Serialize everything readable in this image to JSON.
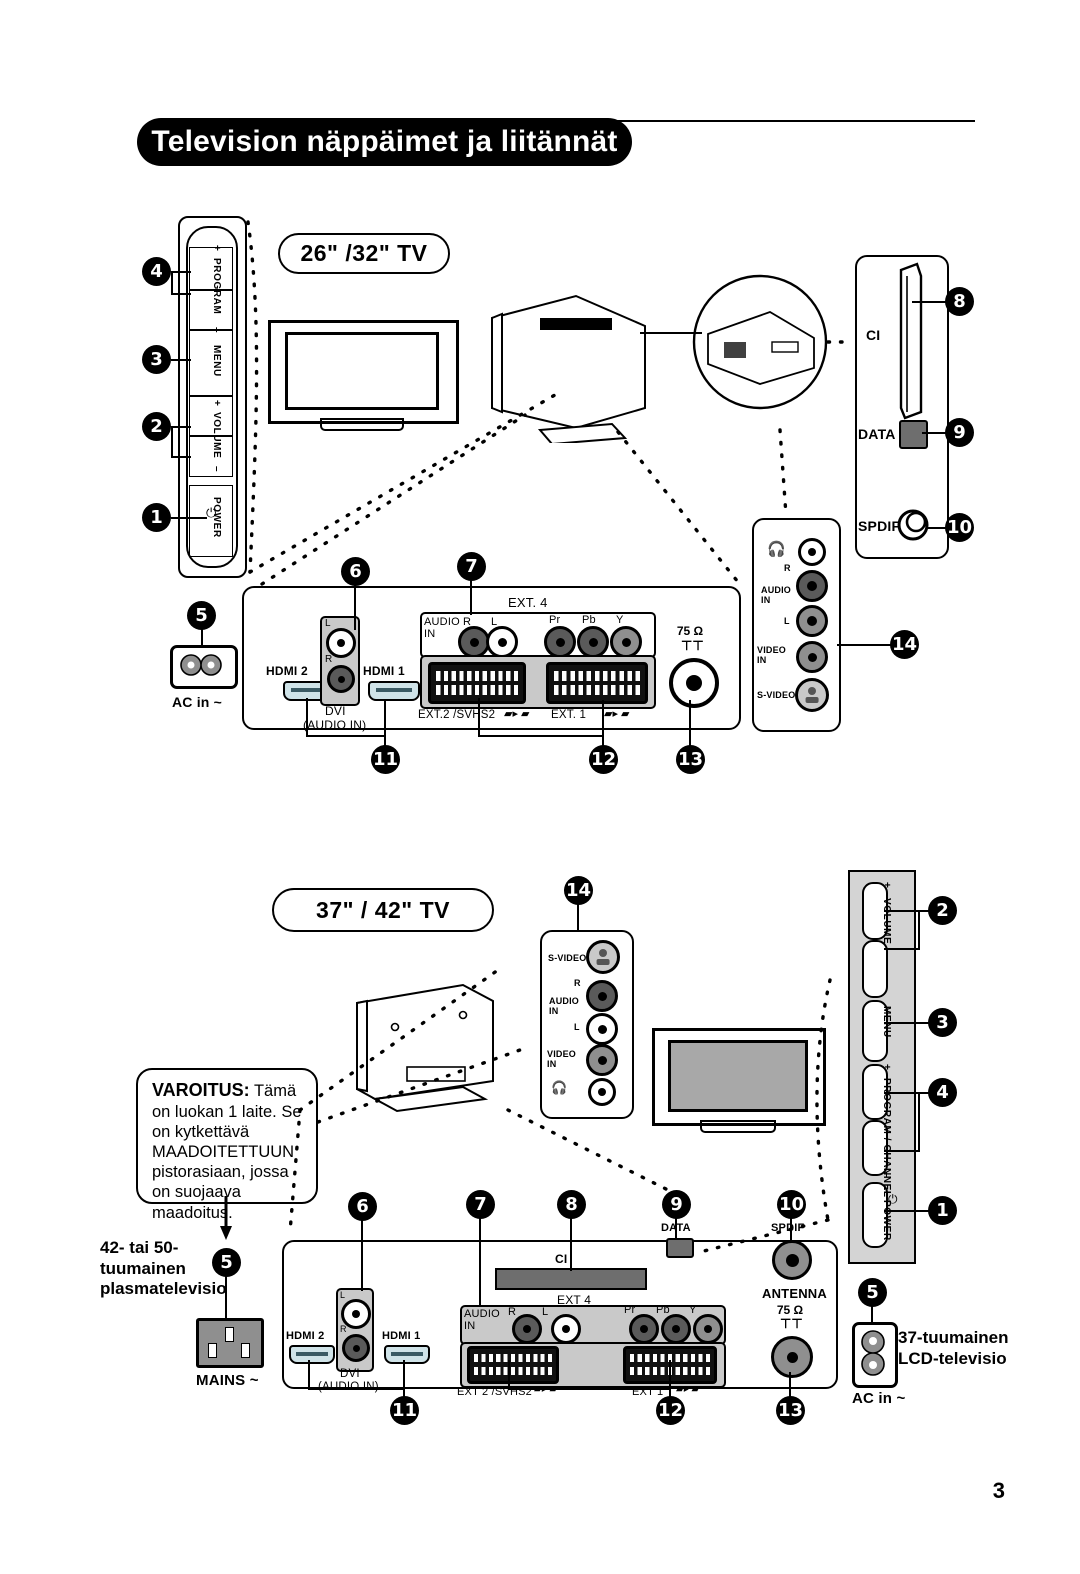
{
  "document": {
    "title": "Television näppäimet ja liitännät",
    "page_number": "3",
    "language": "fi"
  },
  "section_top": {
    "badge_label": "26\" /32\" TV",
    "control_panel": {
      "name": "side-control-panel",
      "buttons": [
        {
          "callout": "4",
          "label": "PROGRAM",
          "plus": "+",
          "minus": "–"
        },
        {
          "callout": "3",
          "label": "MENU"
        },
        {
          "callout": "2",
          "label": "VOLUME",
          "plus": "+",
          "minus": "–"
        },
        {
          "callout": "1",
          "label": "POWER",
          "icon": "power-icon"
        }
      ]
    },
    "ac_in": {
      "callout": "5",
      "label": "AC in ~"
    },
    "right_panel": {
      "ci": {
        "callout": "8",
        "label": "CI"
      },
      "data": {
        "callout": "9",
        "label": "DATA"
      },
      "spdif": {
        "callout": "10",
        "label": "SPDIF"
      }
    },
    "side_jack_panel": {
      "callout": "14",
      "rows": [
        {
          "label": "",
          "icon": "headphone-icon"
        },
        {
          "label": "AUDIO IN",
          "ch_r": "R",
          "ch_l": "L"
        },
        {
          "label": "VIDEO IN"
        },
        {
          "label": "S-VIDEO"
        }
      ]
    },
    "rear_panel": {
      "hdmi2": "HDMI 2",
      "hdmi1": "HDMI 1",
      "dvi": "DVI",
      "dvi_sub": "(AUDIO IN)",
      "dvi_l": "L",
      "dvi_r": "R",
      "ext4": "EXT. 4",
      "audio_in": "AUDIO IN",
      "audio_r": "R",
      "audio_l": "L",
      "comp_pr": "Pr",
      "comp_pb": "Pb",
      "comp_y": "Y",
      "ext2": "EXT.2 /SVHS2",
      "ext1": "EXT. 1",
      "antenna_ohm": "75 Ω",
      "callouts": {
        "dvi": "6",
        "ext4": "7",
        "hdmi": "11",
        "scart": "12",
        "antenna": "13"
      }
    }
  },
  "section_bottom": {
    "badge_label": "37\" / 42\" TV",
    "warning": {
      "heading": "VAROITUS:",
      "text": " Tämä on luokan 1 laite. Se on kytkettävä MAADOITETTUUN pistorasiaan, jossa on suojaava maadoitus."
    },
    "plasma_note": "42- tai 50- tuumainen plasmatelevisio",
    "mains": {
      "callout": "5",
      "label": "MAINS ~"
    },
    "lcd_note": "37-tuumainen LCD-televisio",
    "ac_in": {
      "callout": "5",
      "label": "AC in ~"
    },
    "side_jack_panel": {
      "callout": "14",
      "rows": [
        {
          "label": "S-VIDEO"
        },
        {
          "label": "AUDIO IN",
          "ch_r": "R",
          "ch_l": "L"
        },
        {
          "label": "VIDEO IN"
        },
        {
          "label": "",
          "icon": "headphone-icon"
        }
      ]
    },
    "control_panel": {
      "name": "side-control-panel",
      "buttons": [
        {
          "callout": "2",
          "label": "VOLUME",
          "plus": "+",
          "minus": "–"
        },
        {
          "callout": "3",
          "label": "MENU"
        },
        {
          "callout": "4",
          "label": "PROGRAM / CHANNEL",
          "plus": "+",
          "minus": "–"
        },
        {
          "callout": "1",
          "label": "POWER",
          "icon": "power-icon"
        }
      ]
    },
    "rear_panel": {
      "hdmi2": "HDMI 2",
      "hdmi1": "HDMI 1",
      "dvi": "DVI",
      "dvi_sub": "(AUDIO IN)",
      "dvi_l": "L",
      "dvi_r": "R",
      "ci": "CI",
      "data": "DATA",
      "spdif": "SPDIF",
      "ext4": "EXT 4",
      "audio_in": "AUDIO IN",
      "audio_r": "R",
      "audio_l": "L",
      "comp_pr": "Pr",
      "comp_pb": "Pb",
      "comp_y": "Y",
      "ext2": "EXT 2 /SVHS2",
      "ext1": "EXT 1",
      "antenna": "ANTENNA",
      "antenna_ohm": "75 Ω",
      "callouts": {
        "dvi": "6",
        "ext4": "7",
        "ci": "8",
        "data": "9",
        "spdif": "10",
        "hdmi": "11",
        "scart": "12",
        "antenna": "13"
      }
    }
  }
}
